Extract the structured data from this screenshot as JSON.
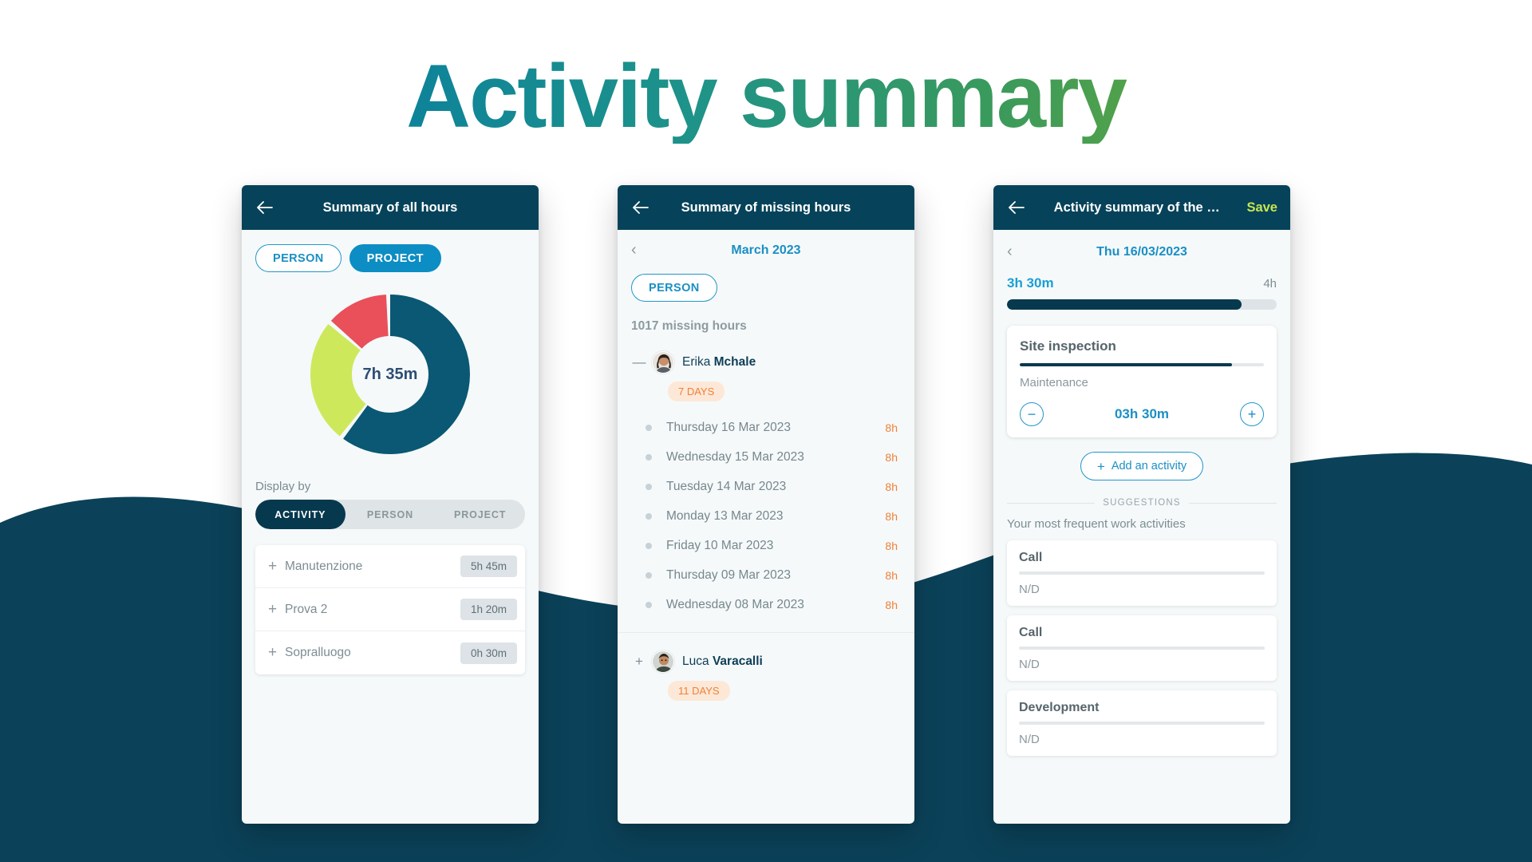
{
  "hero": {
    "title": "Activity summary"
  },
  "colors": {
    "appbar": "#06435a",
    "accent_blue": "#0c8dc4",
    "accent_lime": "#c9e551",
    "donut_teal": "#0a5873",
    "donut_lime": "#cee85c",
    "donut_red": "#e9505a",
    "badge_orange": "#f08037"
  },
  "phone1": {
    "appbar": {
      "back_icon": "arrow-left-icon",
      "title": "Summary of all hours"
    },
    "filters": [
      {
        "label": "PERSON",
        "active": false
      },
      {
        "label": "PROJECT",
        "active": true
      }
    ],
    "donut": {
      "center_label": "7h 35m"
    },
    "display_by_label": "Display by",
    "segments": [
      {
        "label": "ACTIVITY",
        "active": true
      },
      {
        "label": "PERSON",
        "active": false
      },
      {
        "label": "PROJECT",
        "active": false
      }
    ],
    "activities": [
      {
        "expand_icon": "plus-icon",
        "name": "Manutenzione",
        "time": "5h 45m"
      },
      {
        "expand_icon": "plus-icon",
        "name": "Prova 2",
        "time": "1h 20m"
      },
      {
        "expand_icon": "plus-icon",
        "name": "Sopralluogo",
        "time": "0h 30m"
      }
    ]
  },
  "phone2": {
    "appbar": {
      "back_icon": "arrow-left-icon",
      "title": "Summary of missing hours"
    },
    "month_nav": {
      "prev_icon": "chevron-left-icon",
      "label": "March 2023"
    },
    "filters": [
      {
        "label": "PERSON",
        "active": false
      }
    ],
    "missing_hours": "1017 missing hours",
    "groups": [
      {
        "expander": "minus-icon",
        "avatar": "avatar-erika",
        "first_name": "Erika",
        "last_name": "Mchale",
        "days_badge": "7 DAYS",
        "dates": [
          {
            "label": "Thursday 16 Mar 2023",
            "hours": "8h"
          },
          {
            "label": "Wednesday 15 Mar 2023",
            "hours": "8h"
          },
          {
            "label": "Tuesday 14 Mar 2023",
            "hours": "8h"
          },
          {
            "label": "Monday 13 Mar 2023",
            "hours": "8h"
          },
          {
            "label": "Friday 10 Mar 2023",
            "hours": "8h"
          },
          {
            "label": "Thursday 09 Mar 2023",
            "hours": "8h"
          },
          {
            "label": "Wednesday 08 Mar 2023",
            "hours": "8h"
          }
        ]
      },
      {
        "expander": "plus-icon",
        "avatar": "avatar-luca",
        "first_name": "Luca",
        "last_name": "Varacalli",
        "days_badge": "11 DAYS",
        "dates": []
      }
    ]
  },
  "phone3": {
    "appbar": {
      "back_icon": "arrow-left-icon",
      "title": "Activity summary of the …",
      "save_label": "Save"
    },
    "day_nav": {
      "prev_icon": "chevron-left-icon",
      "label": "Thu 16/03/2023"
    },
    "hours": {
      "current": "3h 30m",
      "total": "4h",
      "progress_pct": 87
    },
    "activity_card": {
      "title": "Site inspection",
      "bar_pct": 87,
      "subtitle": "Maintenance",
      "minus_icon": "minus-circle-icon",
      "plus_icon": "plus-circle-icon",
      "value": "03h 30m"
    },
    "add_activity": {
      "icon": "plus-icon",
      "label": "Add an activity"
    },
    "suggestions_header": "SUGGESTIONS",
    "suggestions_desc": "Your most frequent work activities",
    "suggestions": [
      {
        "title": "Call",
        "subtitle": "N/D"
      },
      {
        "title": "Call",
        "subtitle": "N/D"
      },
      {
        "title": "Development",
        "subtitle": "N/D"
      }
    ]
  }
}
